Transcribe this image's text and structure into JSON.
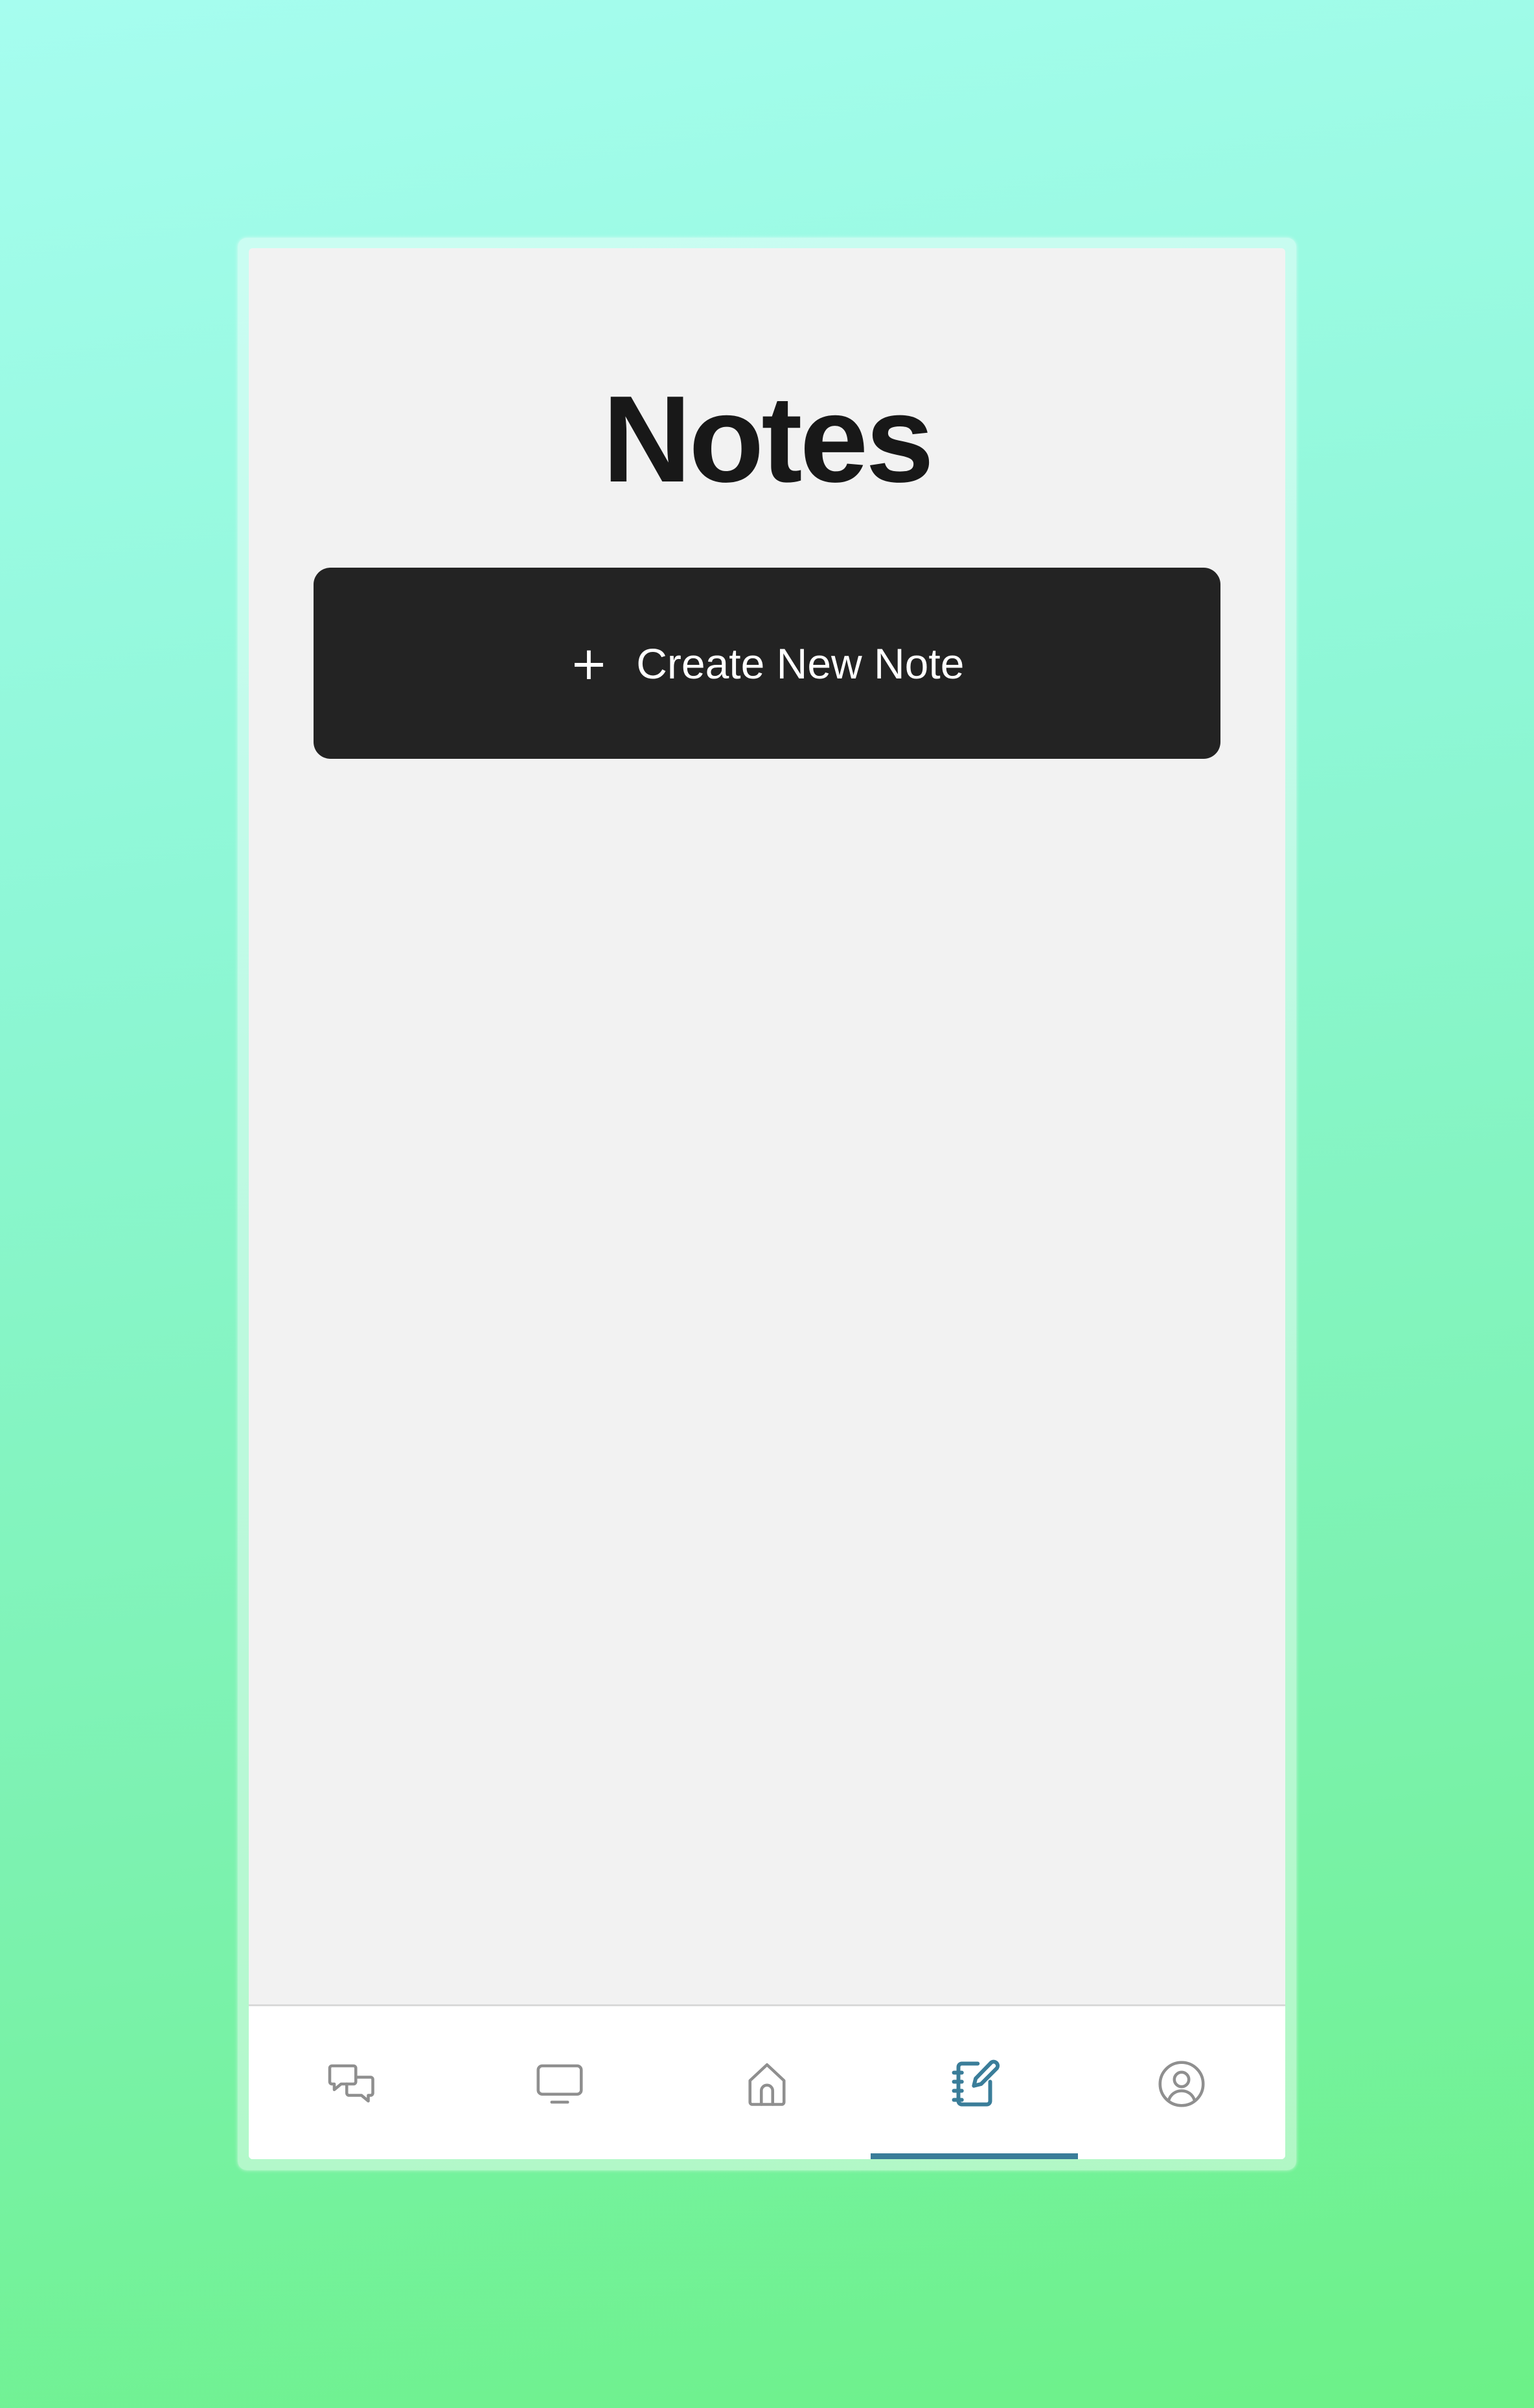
{
  "page": {
    "title": "Notes"
  },
  "create_button": {
    "icon": "plus-icon",
    "label": "Create New Note"
  },
  "bottom_nav": {
    "active_color": "#3a7d99",
    "inactive_color": "#8f8f8f",
    "items": [
      {
        "name": "chat",
        "icon": "chat-bubbles-icon",
        "active": false
      },
      {
        "name": "tv",
        "icon": "monitor-icon",
        "active": false
      },
      {
        "name": "home",
        "icon": "home-icon",
        "active": false
      },
      {
        "name": "notes",
        "icon": "notebook-pen-icon",
        "active": true
      },
      {
        "name": "profile",
        "icon": "user-circle-icon",
        "active": false
      }
    ]
  }
}
